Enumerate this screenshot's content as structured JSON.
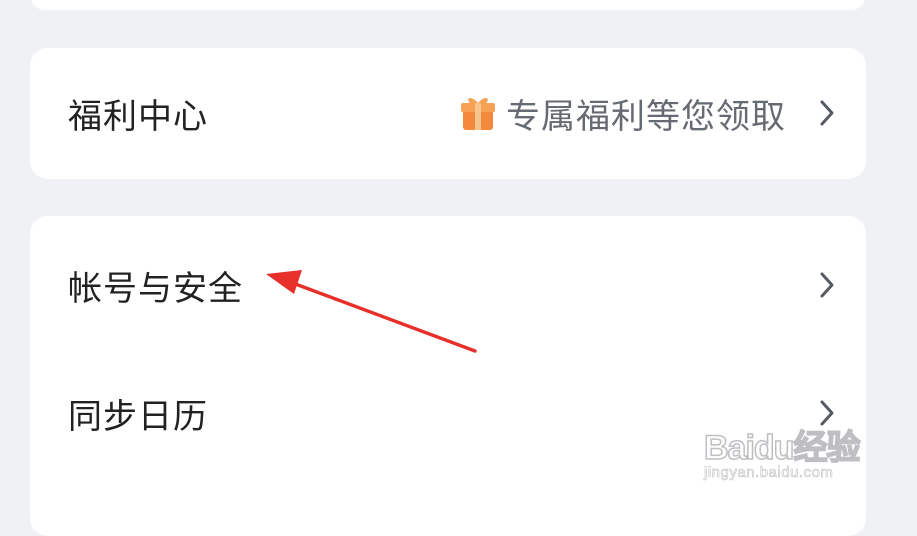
{
  "settings_list": {
    "welfare": {
      "label": "福利中心",
      "value": "专属福利等您领取",
      "icon": "gift-icon"
    },
    "account_security": {
      "label": "帐号与安全"
    },
    "sync_calendar": {
      "label": "同步日历"
    }
  },
  "watermark": {
    "brand": "Baidu经验",
    "url": "jingyan.baidu.com"
  },
  "colors": {
    "background": "#f0f1f5",
    "card": "#ffffff",
    "annotation_arrow": "#e8302a",
    "gift_orange": "#f5893b"
  }
}
